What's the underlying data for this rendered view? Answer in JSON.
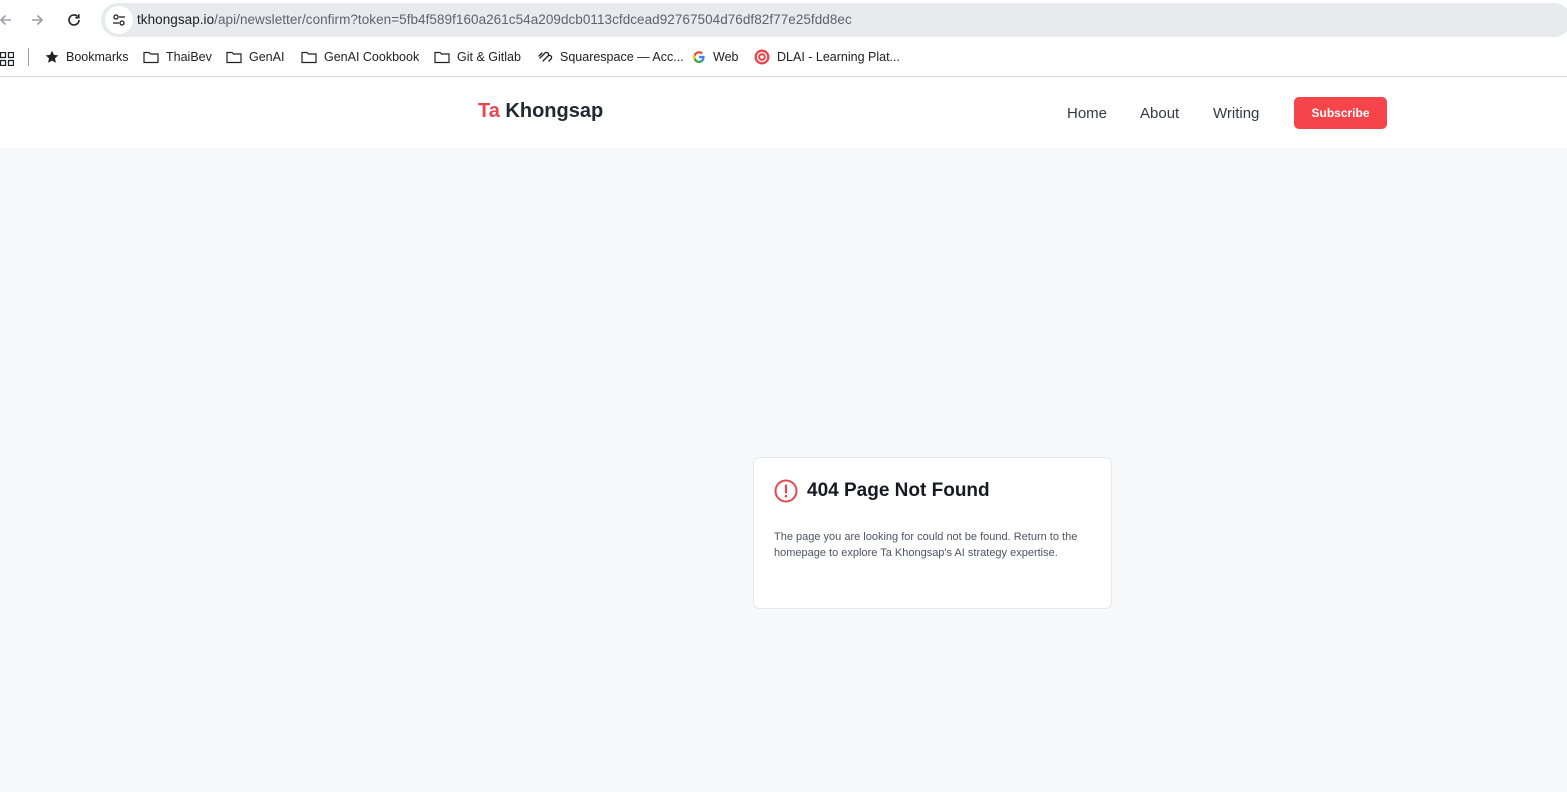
{
  "browser": {
    "url_host": "tkhongsap.io",
    "url_path": "/api/newsletter/confirm?token=5fb4f589f160a261c54a209dcb0113cfdcead92767504d76df82f77e25fdd8ec",
    "icons": [
      "back-arrow-icon",
      "forward-arrow-icon",
      "reload-icon",
      "site-settings-icon",
      "apps-grid-icon"
    ]
  },
  "bookmarks": [
    {
      "label": "Bookmarks",
      "icon": "star-icon"
    },
    {
      "label": "ThaiBev",
      "icon": "folder-icon"
    },
    {
      "label": "GenAI",
      "icon": "folder-icon"
    },
    {
      "label": "GenAI Cookbook",
      "icon": "folder-icon"
    },
    {
      "label": "Git & Gitlab",
      "icon": "folder-icon"
    },
    {
      "label": "Squarespace — Acc...",
      "icon": "squarespace-icon"
    },
    {
      "label": "Web",
      "icon": "google-icon"
    },
    {
      "label": "DLAI - Learning Plat...",
      "icon": "dlai-icon"
    }
  ],
  "site": {
    "logo_first": "Ta",
    "logo_last": "Khongsap",
    "nav": [
      "Home",
      "About",
      "Writing"
    ],
    "subscribe_label": "Subscribe",
    "accent_color": "#e5484d",
    "button_color": "#f5454a"
  },
  "error_card": {
    "icon": "alert-circle-icon",
    "title": "404 Page Not Found",
    "message": "The page you are looking for could not be found. Return to the homepage to explore Ta Khongsap's AI strategy expertise."
  }
}
